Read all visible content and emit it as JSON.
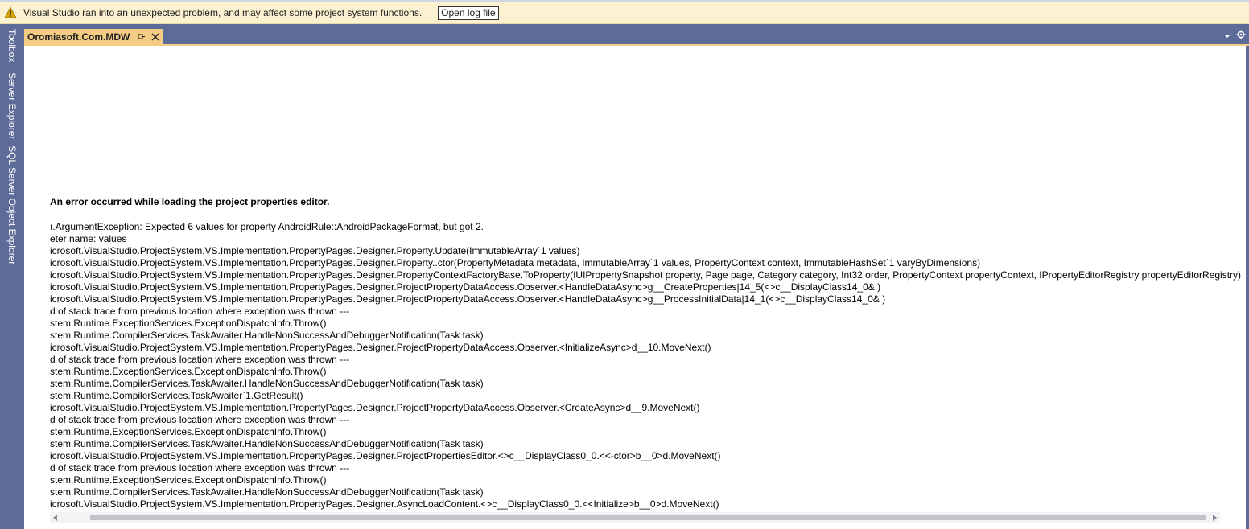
{
  "infobar": {
    "message": "Visual Studio ran into an unexpected problem, and may affect some project system functions.",
    "button_label": "Open log file",
    "warning_color": "#d9a400"
  },
  "left_tabs": [
    {
      "label": "Toolbox"
    },
    {
      "label": "Server Explorer"
    },
    {
      "label": "SQL Server Object Explorer"
    }
  ],
  "document_tab": {
    "label": "Oromiasoft.Com.MDW",
    "accent_color": "#f5cc84"
  },
  "content": {
    "error_title": "An error occurred while loading the project properties editor.",
    "trace_lines": [
      "ı.ArgumentException: Expected 6 values for property AndroidRule::AndroidPackageFormat, but got 2.",
      "eter name: values",
      "icrosoft.VisualStudio.ProjectSystem.VS.Implementation.PropertyPages.Designer.Property.Update(ImmutableArray`1 values)",
      "icrosoft.VisualStudio.ProjectSystem.VS.Implementation.PropertyPages.Designer.Property..ctor(PropertyMetadata metadata, ImmutableArray`1 values, PropertyContext context, ImmutableHashSet`1 varyByDimensions)",
      "icrosoft.VisualStudio.ProjectSystem.VS.Implementation.PropertyPages.Designer.PropertyContextFactoryBase.ToProperty(IUIPropertySnapshot property, Page page, Category category, Int32 order, PropertyContext propertyContext, IPropertyEditorRegistry propertyEditorRegistry)",
      "icrosoft.VisualStudio.ProjectSystem.VS.Implementation.PropertyPages.Designer.ProjectPropertyDataAccess.Observer.<HandleDataAsync>g__CreateProperties|14_5(<>c__DisplayClass14_0& )",
      "icrosoft.VisualStudio.ProjectSystem.VS.Implementation.PropertyPages.Designer.ProjectPropertyDataAccess.Observer.<HandleDataAsync>g__ProcessInitialData|14_1(<>c__DisplayClass14_0& )",
      "d of stack trace from previous location where exception was thrown ---",
      "stem.Runtime.ExceptionServices.ExceptionDispatchInfo.Throw()",
      "stem.Runtime.CompilerServices.TaskAwaiter.HandleNonSuccessAndDebuggerNotification(Task task)",
      "icrosoft.VisualStudio.ProjectSystem.VS.Implementation.PropertyPages.Designer.ProjectPropertyDataAccess.Observer.<InitializeAsync>d__10.MoveNext()",
      "d of stack trace from previous location where exception was thrown ---",
      "stem.Runtime.ExceptionServices.ExceptionDispatchInfo.Throw()",
      "stem.Runtime.CompilerServices.TaskAwaiter.HandleNonSuccessAndDebuggerNotification(Task task)",
      "stem.Runtime.CompilerServices.TaskAwaiter`1.GetResult()",
      "icrosoft.VisualStudio.ProjectSystem.VS.Implementation.PropertyPages.Designer.ProjectPropertyDataAccess.Observer.<CreateAsync>d__9.MoveNext()",
      "d of stack trace from previous location where exception was thrown ---",
      "stem.Runtime.ExceptionServices.ExceptionDispatchInfo.Throw()",
      "stem.Runtime.CompilerServices.TaskAwaiter.HandleNonSuccessAndDebuggerNotification(Task task)",
      "icrosoft.VisualStudio.ProjectSystem.VS.Implementation.PropertyPages.Designer.ProjectPropertiesEditor.<>c__DisplayClass0_0.<<-ctor>b__0>d.MoveNext()",
      "d of stack trace from previous location where exception was thrown ---",
      "stem.Runtime.ExceptionServices.ExceptionDispatchInfo.Throw()",
      "stem.Runtime.CompilerServices.TaskAwaiter.HandleNonSuccessAndDebuggerNotification(Task task)",
      "icrosoft.VisualStudio.ProjectSystem.VS.Implementation.PropertyPages.Designer.AsyncLoadContent.<>c__DisplayClass0_0.<<Initialize>b__0>d.MoveNext()"
    ]
  },
  "icons": {
    "warning": "warning-icon",
    "pin": "pin-icon",
    "close": "close-icon",
    "dropdown": "chevron-down-icon",
    "settings": "gear-icon"
  }
}
